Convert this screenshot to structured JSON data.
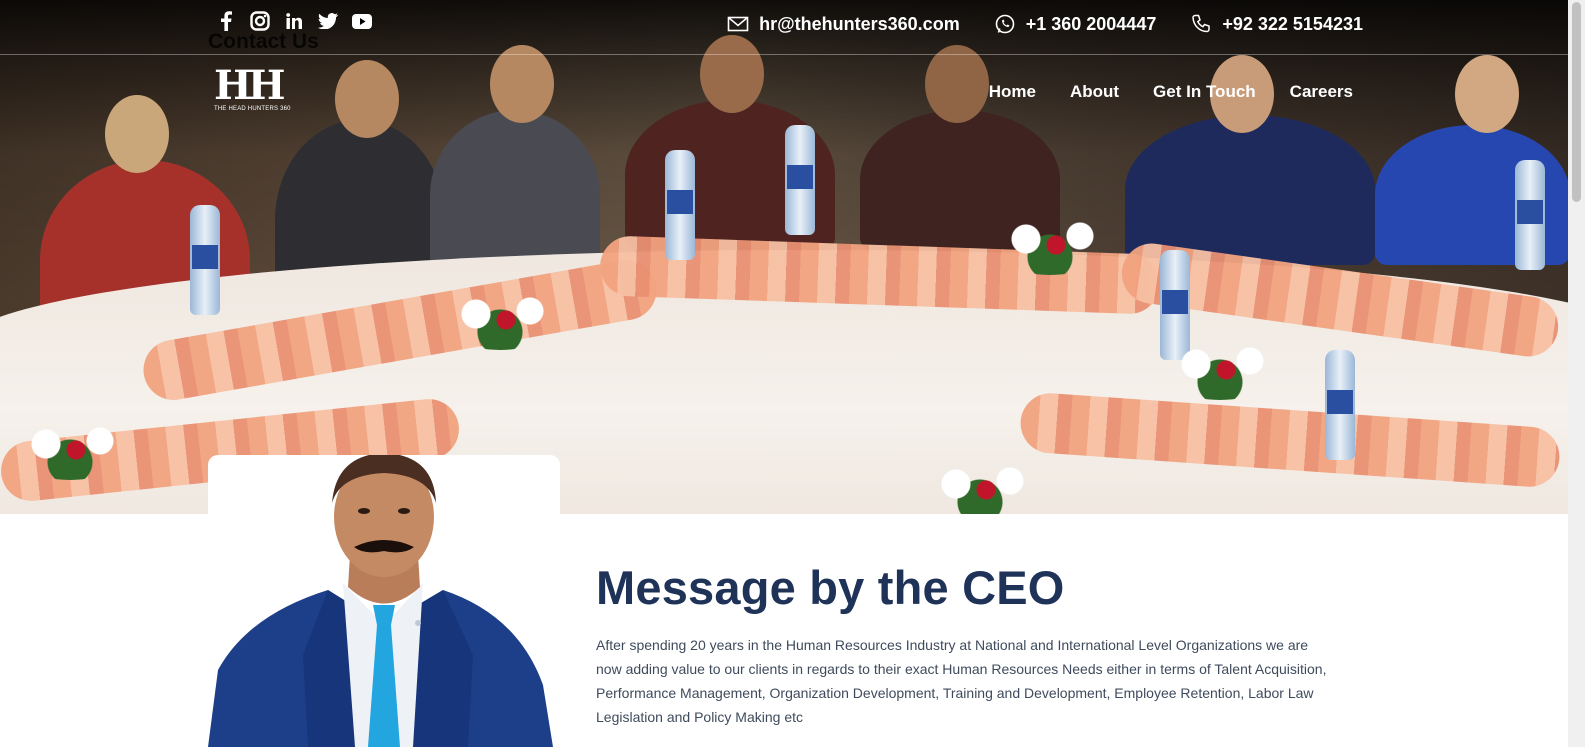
{
  "topbar": {
    "social": [
      {
        "name": "facebook-icon"
      },
      {
        "name": "instagram-icon"
      },
      {
        "name": "linkedin-icon"
      },
      {
        "name": "twitter-icon"
      },
      {
        "name": "youtube-icon"
      }
    ],
    "ghost_text": "Contact Us",
    "contacts": {
      "email": "hr@thehunters360.com",
      "whatsapp": "+1 360 2004447",
      "phone": "+92 322 5154231"
    }
  },
  "logo": {
    "mark": "HH",
    "tagline": "THE HEAD HUNTERS 360"
  },
  "nav": {
    "items": [
      "Home",
      "About",
      "Get In Touch",
      "Careers"
    ]
  },
  "ceo_section": {
    "title": "Message by the CEO",
    "body": "After spending 20 years in the Human Resources Industry at National and International Level Organizations we are now adding value to our clients in regards to their exact Human Resources Needs either in terms of Talent Acquisition, Performance Management, Organization Development, Training and Development, Employee Retention, Labor Law Legislation and Policy Making etc"
  },
  "colors": {
    "title": "#1f3358",
    "body_text": "#3f4b5c",
    "ceo_suit": "#1d3f8a",
    "ceo_tie": "#23a6e0"
  }
}
